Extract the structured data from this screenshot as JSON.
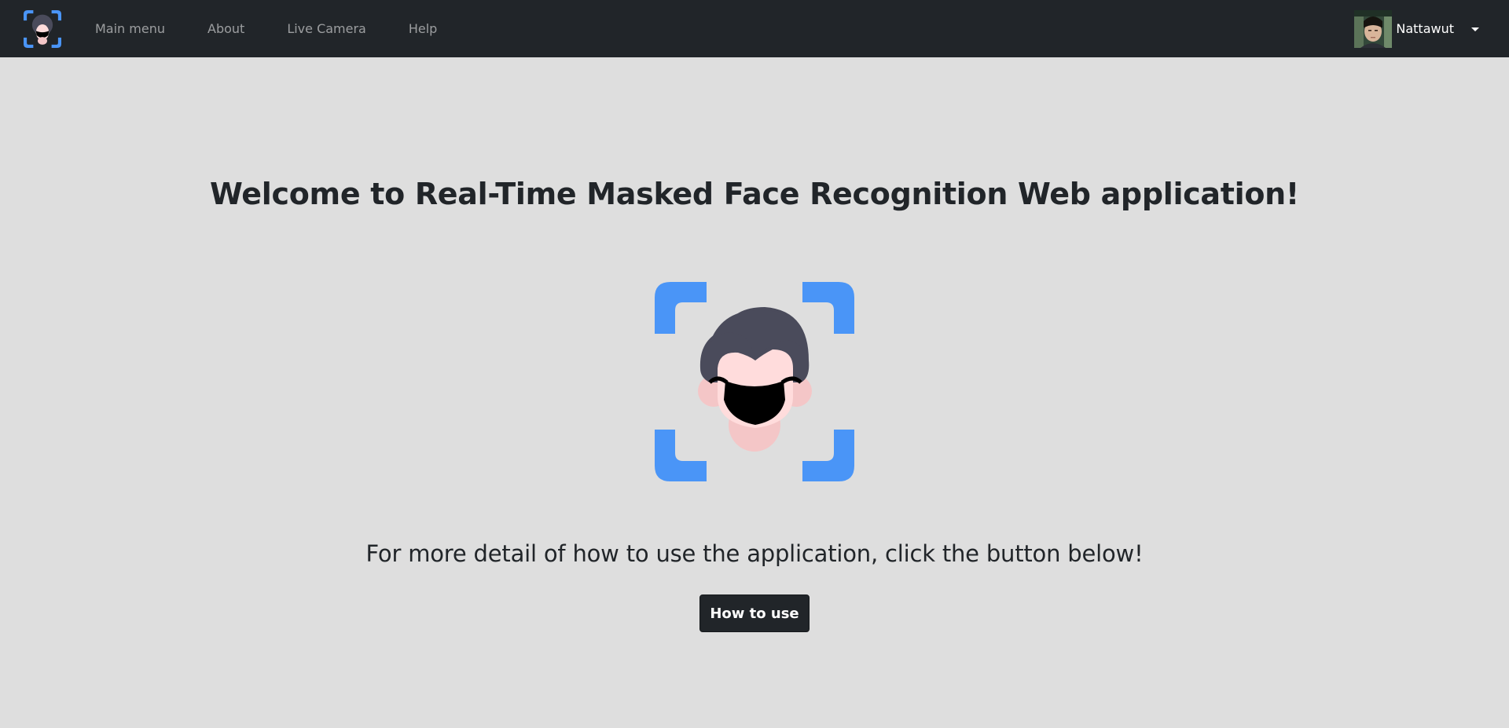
{
  "navbar": {
    "brand_icon": "masked-face-scan-icon",
    "links": [
      {
        "label": "Main menu"
      },
      {
        "label": "About"
      },
      {
        "label": "Live Camera"
      },
      {
        "label": "Help"
      }
    ],
    "user": {
      "name": "Nattawut",
      "avatar_icon": "user-avatar",
      "dropdown_icon": "caret-down-icon"
    }
  },
  "main": {
    "welcome": "Welcome to Real-Time Masked Face Recognition Web application!",
    "hero_icon": "masked-face-scan-icon",
    "subtext": "For more detail of how to use the application, click the button below!",
    "how_to_use_label": "How to use"
  },
  "colors": {
    "navbar_bg": "#212529",
    "page_bg": "#dedede",
    "accent_blue": "#4a95f7",
    "hair": "#4a4b5b",
    "skin": "#ffdcdc",
    "skin_shadow": "#f4c6c7",
    "mask": "#000000",
    "button_bg": "#212529"
  }
}
